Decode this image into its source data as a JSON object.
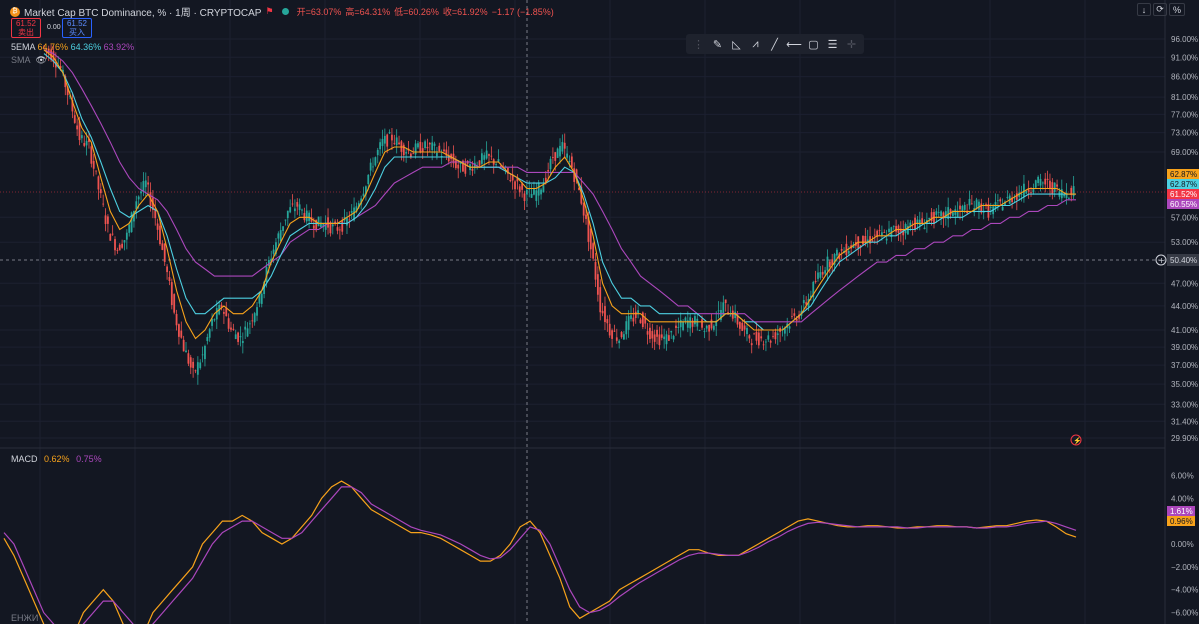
{
  "header": {
    "symbol_logo_icon": "bitcoin-logo-icon",
    "title": "Market Cap BTC Dominance, % · 1周 · CRYPTOCAP",
    "open_label": "开=63.07%",
    "high_label": "高=64.31%",
    "low_label": "低=60.26%",
    "close_label": "收=61.92%",
    "change_label": "−1.17 (−1.85%)",
    "sell_price": "61.52",
    "sell_label": "卖出",
    "spread": "0.00",
    "buy_price": "61.52",
    "buy_label": "买入"
  },
  "indicators": {
    "ema_label": "5EMA",
    "ema_values": [
      "64.76%",
      "64.36%",
      "63.92%"
    ],
    "sma_label": "SMA",
    "macd_label": "MACD",
    "macd_values": [
      "0.62%",
      "0.75%"
    ],
    "bottom_label": "ЕНЖИ"
  },
  "toolbar": {
    "icons": [
      "drag-handle-icon",
      "brush-icon",
      "triangle-icon",
      "pattern-icon",
      "trend-line-icon",
      "horizontal-ray-icon",
      "rectangle-icon",
      "fib-icon",
      "crosshair-icon"
    ]
  },
  "top_right": {
    "arrow_icon": "down-arrow-icon",
    "refresh_icon": "refresh-icon",
    "percent_label": "%"
  },
  "price_axis": [
    "96.00%",
    "91.00%",
    "86.00%",
    "81.00%",
    "77.00%",
    "73.00%",
    "69.00%",
    "57.00%",
    "53.00%",
    "47.00%",
    "44.00%",
    "41.00%",
    "39.00%",
    "37.00%",
    "35.00%",
    "33.00%",
    "31.40%",
    "29.90%"
  ],
  "price_tags": [
    {
      "value": "62.87%",
      "color": "#f7a21b"
    },
    {
      "value": "62.87%",
      "color": "#4dd0e1"
    },
    {
      "value": "61.52%",
      "color": "#f23645"
    },
    {
      "value": "60.55%",
      "color": "#ab47bc"
    }
  ],
  "crosshair_label": "50.40%",
  "macd_axis": [
    "6.00%",
    "4.00%",
    "0.00%",
    "−2.00%",
    "−4.00%",
    "−6.00%"
  ],
  "macd_tags": [
    {
      "value": "1.61%",
      "color": "#ab47bc"
    },
    {
      "value": "0.96%",
      "color": "#f7a21b"
    }
  ],
  "colors": {
    "up": "#26a69a",
    "down": "#ef5350",
    "ema_fast": "#f7a21b",
    "ema_mid": "#4dd0e1",
    "sma": "#ab47bc",
    "macd": "#f7a21b",
    "signal": "#ab47bc"
  },
  "chart_data": [
    {
      "type": "candlestick",
      "title": "Market Cap BTC Dominance, %",
      "ylim": [
        29.9,
        96
      ],
      "y_scale": "log",
      "close_path": [
        94,
        92,
        88,
        80,
        72,
        70,
        62,
        55,
        52,
        54,
        60,
        63,
        57,
        50,
        43,
        39,
        36,
        38,
        42,
        44,
        41,
        40,
        42,
        45,
        50,
        54,
        58,
        59,
        57,
        56,
        56,
        55,
        56,
        58,
        62,
        67,
        71,
        72,
        70,
        69,
        70,
        70,
        69,
        68,
        66,
        66,
        67,
        68,
        67,
        65,
        63,
        61,
        61,
        63,
        68,
        70,
        66,
        60,
        52,
        44,
        41,
        40,
        42,
        43,
        41,
        40,
        40,
        41,
        42,
        42,
        41,
        42,
        44,
        43,
        41,
        40,
        40,
        40,
        41,
        42,
        43,
        45,
        48,
        50,
        51,
        52,
        53,
        53,
        54,
        54,
        55,
        55,
        56,
        56,
        57,
        57,
        58,
        58,
        59,
        59,
        58,
        59,
        60,
        61,
        62,
        63,
        63,
        62,
        61,
        62
      ],
      "ema_fast": [
        93,
        91,
        87,
        80,
        74,
        71,
        64,
        58,
        55,
        56,
        59,
        61,
        58,
        52,
        46,
        42,
        40,
        41,
        43,
        44,
        43,
        43,
        44,
        46,
        50,
        53,
        56,
        57,
        57,
        56,
        56,
        56,
        57,
        58,
        61,
        65,
        69,
        70,
        70,
        69,
        69,
        69,
        69,
        68,
        67,
        66,
        66,
        67,
        67,
        65,
        64,
        62,
        62,
        63,
        66,
        68,
        65,
        60,
        54,
        47,
        44,
        43,
        43,
        43,
        42,
        42,
        42,
        42,
        42,
        42,
        42,
        42,
        43,
        43,
        42,
        41,
        41,
        41,
        41,
        42,
        43,
        45,
        47,
        49,
        51,
        52,
        53,
        53,
        54,
        54,
        55,
        55,
        56,
        56,
        57,
        57,
        58,
        58,
        58,
        59,
        59,
        59,
        60,
        61,
        62,
        62,
        62,
        62,
        61,
        61
      ],
      "ema_mid": [
        92,
        90,
        87,
        82,
        76,
        72,
        67,
        62,
        58,
        57,
        58,
        59,
        58,
        54,
        49,
        45,
        43,
        43,
        44,
        45,
        45,
        45,
        45,
        46,
        48,
        51,
        54,
        55,
        56,
        56,
        56,
        56,
        56,
        57,
        59,
        62,
        66,
        68,
        68,
        68,
        68,
        68,
        68,
        68,
        67,
        66,
        66,
        66,
        66,
        65,
        64,
        63,
        63,
        63,
        64,
        66,
        65,
        61,
        56,
        50,
        47,
        45,
        45,
        44,
        44,
        43,
        43,
        43,
        43,
        43,
        42,
        42,
        43,
        43,
        42,
        42,
        41,
        41,
        41,
        42,
        43,
        44,
        46,
        48,
        50,
        51,
        52,
        53,
        53,
        54,
        54,
        55,
        55,
        56,
        56,
        57,
        57,
        57,
        58,
        58,
        58,
        59,
        59,
        60,
        61,
        61,
        61,
        61,
        61,
        61
      ],
      "sma": [
        93,
        92,
        90,
        87,
        83,
        79,
        75,
        71,
        67,
        64,
        62,
        61,
        60,
        58,
        55,
        52,
        50,
        49,
        48,
        48,
        48,
        48,
        48,
        49,
        50,
        51,
        53,
        54,
        55,
        55,
        56,
        56,
        56,
        57,
        58,
        59,
        61,
        63,
        64,
        65,
        66,
        66,
        66,
        67,
        67,
        67,
        66,
        66,
        66,
        66,
        66,
        65,
        65,
        65,
        65,
        65,
        65,
        63,
        61,
        58,
        55,
        52,
        50,
        48,
        47,
        46,
        45,
        44,
        44,
        43,
        43,
        43,
        43,
        43,
        43,
        42,
        42,
        42,
        42,
        42,
        42,
        43,
        44,
        45,
        46,
        47,
        48,
        49,
        50,
        50,
        51,
        51,
        52,
        52,
        53,
        53,
        54,
        54,
        55,
        55,
        56,
        56,
        57,
        57,
        58,
        58,
        59,
        59,
        60,
        60
      ]
    },
    {
      "type": "line",
      "title": "MACD",
      "ylim": [
        -7,
        7
      ],
      "series": [
        {
          "name": "MACD",
          "values": [
            0.5,
            -1,
            -3,
            -5,
            -7,
            -8,
            -8,
            -8,
            -6,
            -5,
            -4,
            -5,
            -7,
            -8,
            -8,
            -6,
            -5,
            -4,
            -3,
            -2,
            0,
            1,
            2,
            2,
            2.5,
            2,
            1,
            0.5,
            0,
            0.5,
            1.5,
            2.5,
            4,
            5,
            5.5,
            5,
            4,
            3,
            2.5,
            2,
            1.5,
            1,
            1,
            0.8,
            0.5,
            0,
            -0.5,
            -1,
            -1.5,
            -1.5,
            -1,
            0,
            1.5,
            2,
            1,
            -1,
            -3,
            -5.5,
            -6.5,
            -6,
            -5.5,
            -5,
            -4,
            -3.5,
            -3,
            -2.5,
            -2,
            -1.5,
            -1,
            -0.5,
            -0.5,
            -0.8,
            -1,
            -1,
            -1,
            -0.5,
            0,
            0.5,
            1,
            1.5,
            2,
            2.2,
            2,
            1.8,
            1.6,
            1.5,
            1.5,
            1.6,
            1.6,
            1.5,
            1.4,
            1.4,
            1.5,
            1.5,
            1.6,
            1.6,
            1.5,
            1.5,
            1.4,
            1.5,
            1.6,
            1.6,
            1.8,
            2,
            2.1,
            2,
            1.5,
            0.9,
            0.6
          ]
        },
        {
          "name": "Signal",
          "values": [
            1,
            0,
            -2,
            -4,
            -6,
            -7,
            -8,
            -8,
            -7,
            -6,
            -5,
            -5,
            -6,
            -7,
            -8,
            -7,
            -6,
            -5,
            -4,
            -3,
            -1.5,
            0,
            1,
            1.5,
            2,
            2,
            1.5,
            1,
            0.5,
            0.5,
            1,
            2,
            3,
            4,
            5,
            5,
            4.5,
            3.5,
            3,
            2.5,
            2,
            1.5,
            1.2,
            1,
            0.8,
            0.4,
            0,
            -0.5,
            -1,
            -1.3,
            -1.2,
            -0.5,
            0.5,
            1.5,
            1.2,
            0,
            -2,
            -4,
            -5.5,
            -6,
            -5.8,
            -5.3,
            -4.6,
            -4,
            -3.4,
            -2.9,
            -2.4,
            -1.9,
            -1.4,
            -1,
            -0.8,
            -0.8,
            -0.9,
            -1,
            -1,
            -0.7,
            -0.3,
            0.2,
            0.6,
            1.1,
            1.5,
            1.8,
            1.9,
            1.8,
            1.7,
            1.6,
            1.5,
            1.5,
            1.5,
            1.5,
            1.5,
            1.4,
            1.4,
            1.5,
            1.5,
            1.5,
            1.5,
            1.5,
            1.4,
            1.4,
            1.5,
            1.5,
            1.6,
            1.8,
            1.9,
            2,
            1.8,
            1.5,
            1.2
          ]
        }
      ]
    }
  ]
}
